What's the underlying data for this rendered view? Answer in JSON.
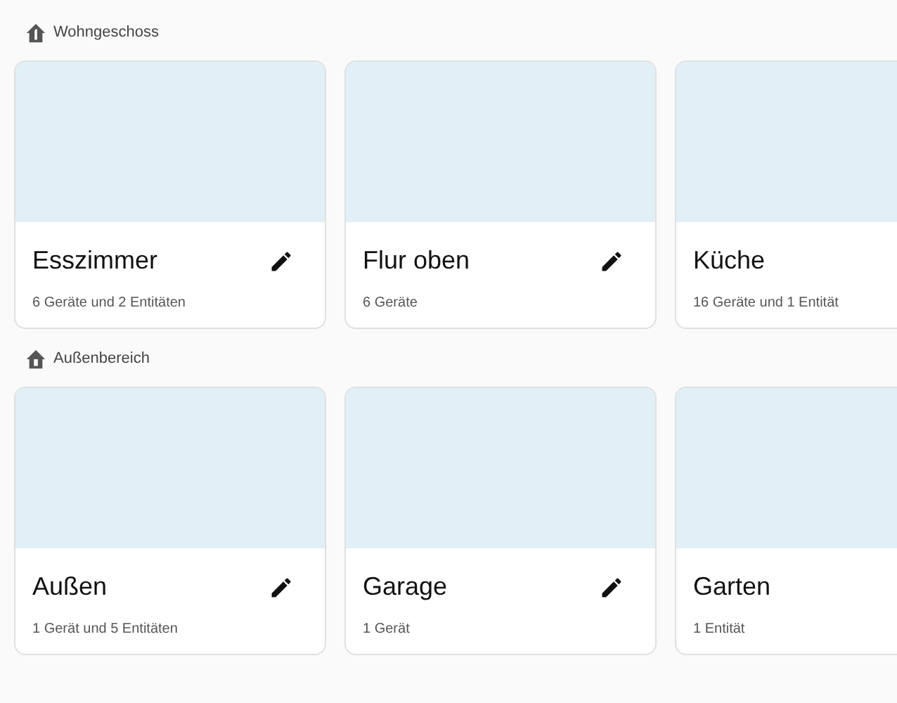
{
  "floors": [
    {
      "name": "Wohngeschoss",
      "kind": "floor",
      "areas": [
        {
          "name": "Esszimmer",
          "summary": "6 Geräte und 2 Entitäten"
        },
        {
          "name": "Flur oben",
          "summary": "6 Geräte"
        },
        {
          "name": "Küche",
          "summary": "16 Geräte und 1 Entität"
        }
      ]
    },
    {
      "name": "Außenbereich",
      "kind": "outside",
      "areas": [
        {
          "name": "Außen",
          "summary": "1 Gerät und 5 Entitäten"
        },
        {
          "name": "Garage",
          "summary": "1 Gerät"
        },
        {
          "name": "Garten",
          "summary": "1 Entität"
        }
      ]
    }
  ]
}
